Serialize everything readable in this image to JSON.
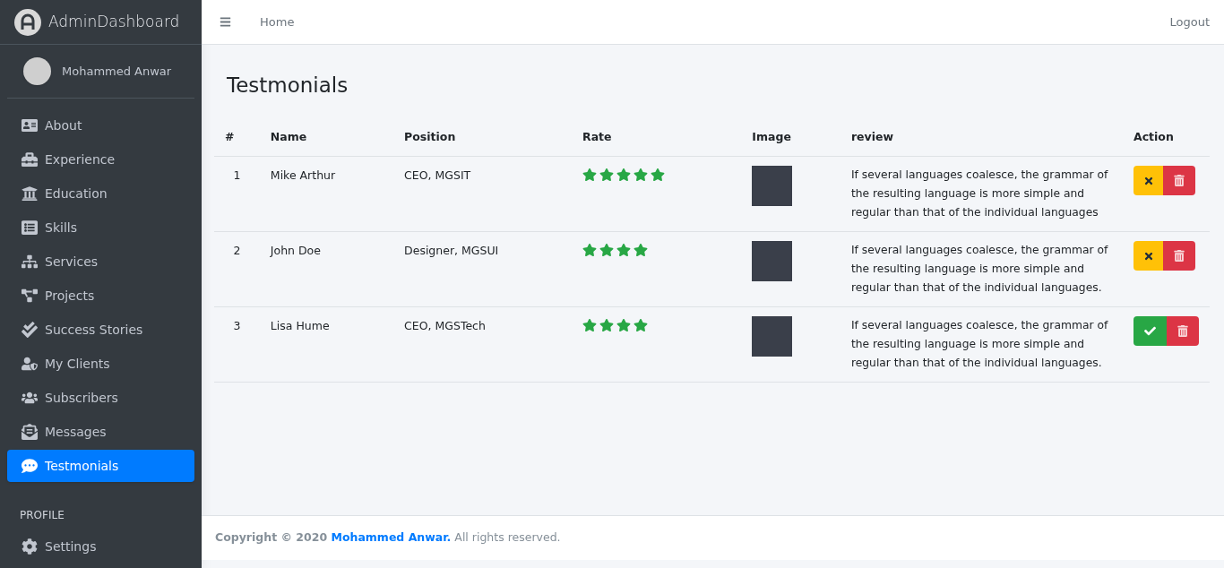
{
  "brand": {
    "title": "AdminDashboard"
  },
  "user": {
    "name": "Mohammed Anwar"
  },
  "sidebar": {
    "items": [
      {
        "label": "About",
        "selected": false
      },
      {
        "label": "Experience",
        "selected": false
      },
      {
        "label": "Education",
        "selected": false
      },
      {
        "label": "Skills",
        "selected": false
      },
      {
        "label": "Services",
        "selected": false
      },
      {
        "label": "Projects",
        "selected": false
      },
      {
        "label": "Success Stories",
        "selected": false
      },
      {
        "label": "My Clients",
        "selected": false
      },
      {
        "label": "Subscribers",
        "selected": false
      },
      {
        "label": "Messages",
        "selected": false
      },
      {
        "label": "Testmonials",
        "selected": true
      }
    ],
    "section": "PROFILE",
    "profile_items": [
      {
        "label": "Settings",
        "selected": false
      }
    ]
  },
  "topbar": {
    "links": [
      "Home"
    ],
    "logout": "Logout"
  },
  "page": {
    "title": "Testmonials"
  },
  "table": {
    "columns": [
      "#",
      "Name",
      "Position",
      "Rate",
      "Image",
      "review",
      "Action"
    ],
    "rows": [
      {
        "index": "1",
        "name": "Mike Arthur",
        "position": "CEO, MGSIT",
        "stars": 5,
        "review": "If several languages coalesce, the grammar of the resulting language is more simple and regular than that of the individual languages",
        "approved": true
      },
      {
        "index": "2",
        "name": "John Doe",
        "position": "Designer, MGSUI",
        "stars": 4,
        "review": "If several languages coalesce, the grammar of the resulting language is more simple and regular than that of the individual languages.",
        "approved": true
      },
      {
        "index": "3",
        "name": "Lisa Hume",
        "position": "CEO, MGSTech",
        "stars": 4,
        "review": "If several languages coalesce, the grammar of the resulting language is more simple and regular than that of the individual languages.",
        "approved": false
      }
    ]
  },
  "footer": {
    "prefix": "Copyright © 2020",
    "link": "Mohammed Anwar.",
    "suffix": "All rights reserved."
  }
}
